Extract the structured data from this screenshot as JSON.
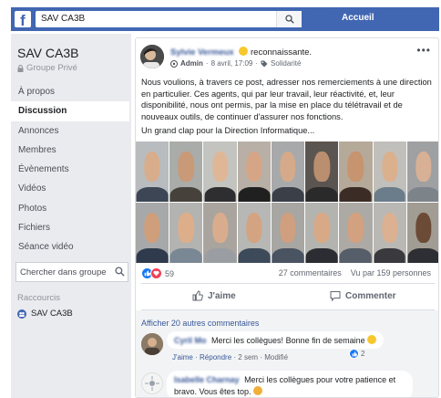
{
  "topbar": {
    "search_value": "SAV CA3B",
    "home_label": "Accueil",
    "logo_letter": "f",
    "bar_color": "#4267b2"
  },
  "sidebar": {
    "group_name": "SAV CA3B",
    "group_type": "Groupe Privé",
    "nav": [
      {
        "label": "À propos",
        "active": false
      },
      {
        "label": "Discussion",
        "active": true
      },
      {
        "label": "Annonces",
        "active": false
      },
      {
        "label": "Membres",
        "active": false
      },
      {
        "label": "Évènements",
        "active": false
      },
      {
        "label": "Vidéos",
        "active": false
      },
      {
        "label": "Photos",
        "active": false
      },
      {
        "label": "Fichiers",
        "active": false
      },
      {
        "label": "Séance vidéo",
        "active": false
      }
    ],
    "search_placeholder": "Chercher dans groupe",
    "shortcuts_title": "Raccourcis",
    "shortcut_label": "SAV CA3B"
  },
  "post": {
    "author": "Sylvie Vermeux",
    "feeling": "reconnaissante.",
    "role": "Admin",
    "date": "8 avril, 17:09",
    "topic": "Solidarité",
    "text": "Nous voulions, à travers ce post, adresser nos remerciements à une direction en particulier. Ces agents, qui par leur travail, leur réactivité, et, leur disponibilité, nous ont permis, par la mise en place du télétravail et de nouveaux outils, de continuer d'assurer nos fonctions.",
    "text2": "Un grand clap pour la Direction Informatique...",
    "reactions_count": "59",
    "comments_count": "27 commentaires",
    "views": "Vu par 159 personnes",
    "like_label": "J'aime",
    "comment_label": "Commenter"
  },
  "comments": {
    "more_label": "Afficher 20 autres commentaires",
    "items": [
      {
        "author": "Cyril Mo",
        "text": "Merci les collègues! Bonne fin de semaine",
        "like_link": "J'aime",
        "reply_link": "Répondre",
        "age": "2 sem",
        "edited": "Modifié",
        "likes": "2"
      },
      {
        "author": "Isabelle Charnay",
        "text": "Merci les collègues pour votre patience et bravo. Vous êtes top."
      }
    ]
  },
  "colors": {
    "link": "#385898",
    "sidebar_bg": "#e9ebee",
    "like_blue": "#1877f2",
    "love_red": "#f33e58"
  },
  "icons": [
    "search-icon",
    "lock-icon",
    "globe-icon",
    "tag-icon",
    "thumbs-up-icon",
    "comment-icon",
    "more-icon"
  ]
}
